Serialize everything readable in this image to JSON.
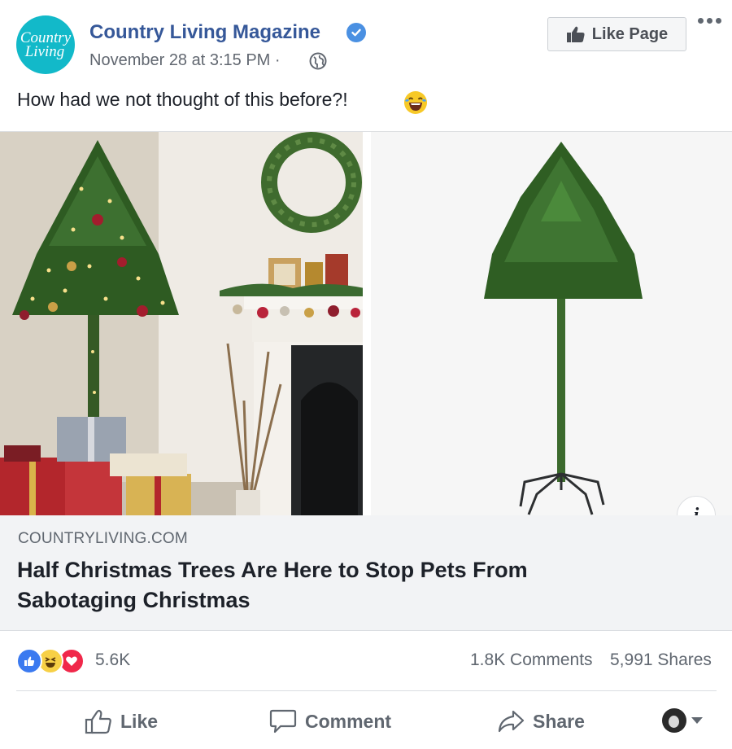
{
  "page": {
    "avatar_line1": "Country",
    "avatar_line2": "Living",
    "name": "Country Living Magazine",
    "timestamp": "November 28 at 3:15 PM ·",
    "like_page_label": "Like Page"
  },
  "post": {
    "text": "How had we not thought of this before?!"
  },
  "link_preview": {
    "domain": "COUNTRYLIVING.COM",
    "headline": "Half Christmas Trees Are Here to Stop Pets From Sabotaging Christmas",
    "info_glyph": "i"
  },
  "stats": {
    "reactions_count": "5.6K",
    "comments": "1.8K Comments",
    "shares": "5,991 Shares",
    "reaction_types": [
      "like-icon",
      "haha-icon",
      "love-icon"
    ]
  },
  "actions": {
    "like": "Like",
    "comment": "Comment",
    "share": "Share"
  },
  "colors": {
    "link_blue": "#365899",
    "verified": "#4a90e2",
    "avatar_teal": "#12b9c9",
    "meta_gray": "#616770",
    "link_box_bg": "#f2f3f5"
  }
}
